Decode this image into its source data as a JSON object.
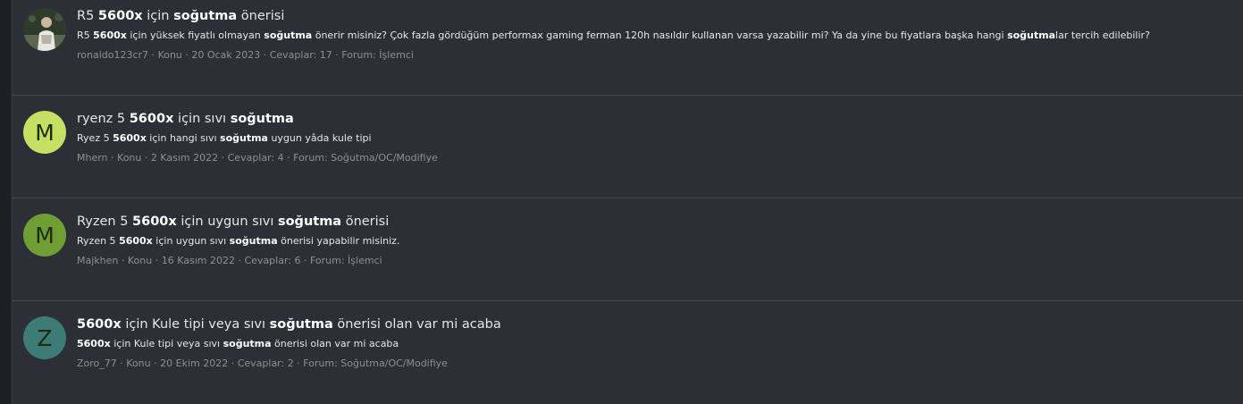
{
  "results": [
    {
      "avatar": {
        "type": "photo",
        "letter": "",
        "color": "#3a4a34"
      },
      "title": [
        {
          "text": "R5 ",
          "bold": false
        },
        {
          "text": "5600x",
          "bold": true
        },
        {
          "text": " için ",
          "bold": false
        },
        {
          "text": "soğutma",
          "bold": true
        },
        {
          "text": " önerisi",
          "bold": false
        }
      ],
      "snippet": [
        {
          "text": "R5 ",
          "bold": false
        },
        {
          "text": "5600x",
          "bold": true
        },
        {
          "text": " için yüksek fiyatlı olmayan ",
          "bold": false
        },
        {
          "text": "soğutma",
          "bold": true
        },
        {
          "text": " önerir misiniz? Çok fazla gördüğüm performax gaming ferman 120h nasıldır kullanan varsa yazabilir mi? Ya da yine bu fiyatlara başka hangi ",
          "bold": false
        },
        {
          "text": "soğutma",
          "bold": true
        },
        {
          "text": "lar tercih edilebilir?",
          "bold": false
        }
      ],
      "meta": {
        "author": "ronaldo123cr7",
        "type": "Konu",
        "date": "20 Ocak 2023",
        "replies": "Cevaplar: 17",
        "forum": "Forum: İşlemci"
      }
    },
    {
      "avatar": {
        "type": "letter",
        "letter": "M",
        "color": "#c5e063"
      },
      "title": [
        {
          "text": "ryenz 5 ",
          "bold": false
        },
        {
          "text": "5600x",
          "bold": true
        },
        {
          "text": " için sıvı ",
          "bold": false
        },
        {
          "text": "soğutma",
          "bold": true
        }
      ],
      "snippet": [
        {
          "text": "Ryez 5 ",
          "bold": false
        },
        {
          "text": "5600x",
          "bold": true
        },
        {
          "text": " için hangi sıvı ",
          "bold": false
        },
        {
          "text": "soğutma",
          "bold": true
        },
        {
          "text": " uygun yâda kule tipi",
          "bold": false
        }
      ],
      "meta": {
        "author": "Mhern",
        "type": "Konu",
        "date": "2 Kasım 2022",
        "replies": "Cevaplar: 4",
        "forum": "Forum: Soğutma/OC/Modifiye"
      }
    },
    {
      "avatar": {
        "type": "letter",
        "letter": "M",
        "color": "#6f9e34"
      },
      "title": [
        {
          "text": "Ryzen 5 ",
          "bold": false
        },
        {
          "text": "5600x",
          "bold": true
        },
        {
          "text": " için uygun sıvı ",
          "bold": false
        },
        {
          "text": "soğutma",
          "bold": true
        },
        {
          "text": " önerisi",
          "bold": false
        }
      ],
      "snippet": [
        {
          "text": "Ryzen 5 ",
          "bold": false
        },
        {
          "text": "5600x",
          "bold": true
        },
        {
          "text": " için uygun sıvı ",
          "bold": false
        },
        {
          "text": "soğutma",
          "bold": true
        },
        {
          "text": " önerisi yapabilir misiniz.",
          "bold": false
        }
      ],
      "meta": {
        "author": "Majkhen",
        "type": "Konu",
        "date": "16 Kasım 2022",
        "replies": "Cevaplar: 6",
        "forum": "Forum: İşlemci"
      }
    },
    {
      "avatar": {
        "type": "letter",
        "letter": "Z",
        "color": "#3d7c76"
      },
      "title": [
        {
          "text": "5600x",
          "bold": true
        },
        {
          "text": " için Kule tipi veya sıvı ",
          "bold": false
        },
        {
          "text": "soğutma",
          "bold": true
        },
        {
          "text": " önerisi olan var mi acaba",
          "bold": false
        }
      ],
      "snippet": [
        {
          "text": "5600x",
          "bold": true
        },
        {
          "text": " için Kule tipi veya sıvı ",
          "bold": false
        },
        {
          "text": "soğutma",
          "bold": true
        },
        {
          "text": " önerisi olan var mi acaba",
          "bold": false
        }
      ],
      "meta": {
        "author": "Zoro_77",
        "type": "Konu",
        "date": "20 Ekim 2022",
        "replies": "Cevaplar: 2",
        "forum": "Forum: Soğutma/OC/Modifiye"
      }
    }
  ],
  "meta_separator": " · "
}
